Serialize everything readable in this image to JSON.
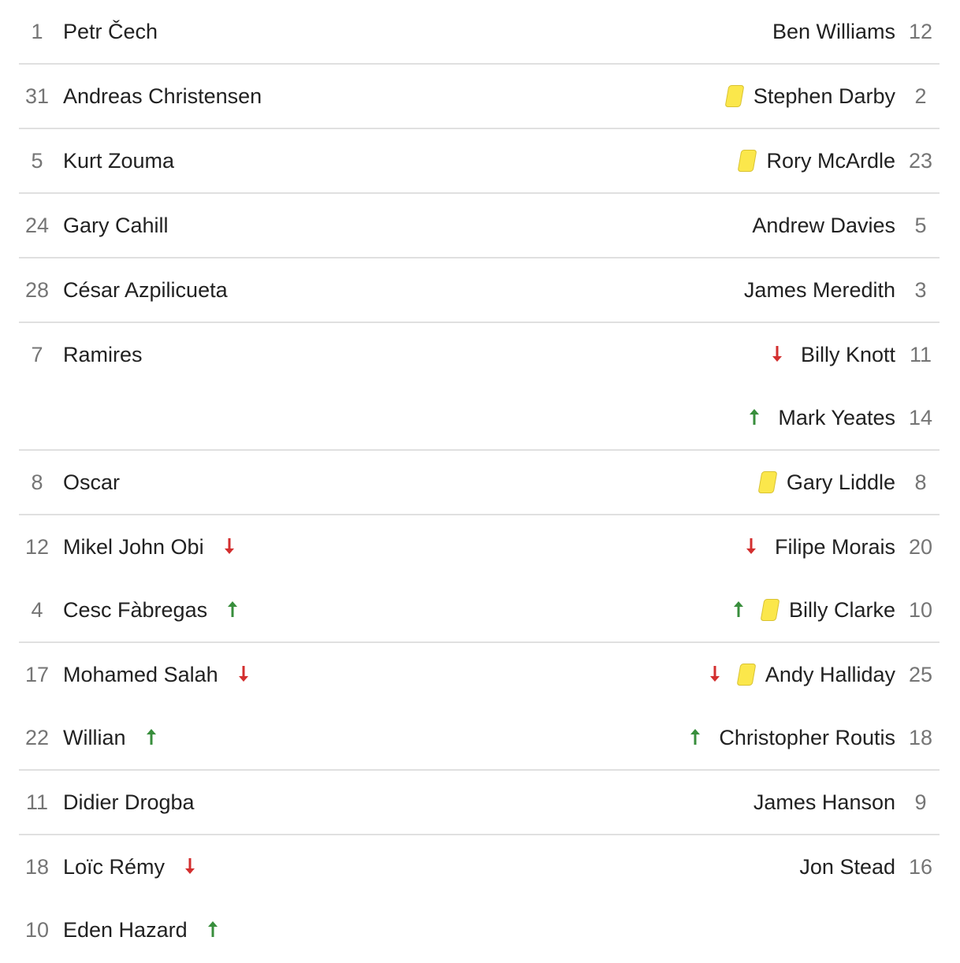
{
  "colors": {
    "sub_off": "#d32f2f",
    "sub_on": "#388e3c",
    "yellow_card": "#fbe74b"
  },
  "groups": [
    {
      "home": [
        {
          "num": "1",
          "name": "Petr Čech",
          "icons": []
        }
      ],
      "away": [
        {
          "num": "12",
          "name": "Ben Williams",
          "icons": []
        }
      ]
    },
    {
      "home": [
        {
          "num": "31",
          "name": "Andreas Christensen",
          "icons": []
        }
      ],
      "away": [
        {
          "num": "2",
          "name": "Stephen Darby",
          "icons": [
            "yellow-card"
          ]
        }
      ]
    },
    {
      "home": [
        {
          "num": "5",
          "name": "Kurt Zouma",
          "icons": []
        }
      ],
      "away": [
        {
          "num": "23",
          "name": "Rory McArdle",
          "icons": [
            "yellow-card"
          ]
        }
      ]
    },
    {
      "home": [
        {
          "num": "24",
          "name": "Gary Cahill",
          "icons": []
        }
      ],
      "away": [
        {
          "num": "5",
          "name": "Andrew Davies",
          "icons": []
        }
      ]
    },
    {
      "home": [
        {
          "num": "28",
          "name": "César Azpilicueta",
          "icons": []
        }
      ],
      "away": [
        {
          "num": "3",
          "name": "James Meredith",
          "icons": []
        }
      ]
    },
    {
      "home": [
        {
          "num": "7",
          "name": "Ramires",
          "icons": []
        }
      ],
      "away": [
        {
          "num": "11",
          "name": "Billy Knott",
          "icons": [
            "sub-off"
          ]
        },
        {
          "num": "14",
          "name": "Mark Yeates",
          "icons": [
            "sub-on"
          ]
        }
      ]
    },
    {
      "home": [
        {
          "num": "8",
          "name": "Oscar",
          "icons": []
        }
      ],
      "away": [
        {
          "num": "8",
          "name": "Gary Liddle",
          "icons": [
            "yellow-card"
          ]
        }
      ]
    },
    {
      "home": [
        {
          "num": "12",
          "name": "Mikel John Obi",
          "icons": [
            "sub-off"
          ]
        },
        {
          "num": "4",
          "name": "Cesc Fàbregas",
          "icons": [
            "sub-on"
          ]
        }
      ],
      "away": [
        {
          "num": "20",
          "name": "Filipe Morais",
          "icons": [
            "sub-off"
          ]
        },
        {
          "num": "10",
          "name": "Billy Clarke",
          "icons": [
            "sub-on",
            "yellow-card"
          ]
        }
      ]
    },
    {
      "home": [
        {
          "num": "17",
          "name": "Mohamed Salah",
          "icons": [
            "sub-off"
          ]
        },
        {
          "num": "22",
          "name": "Willian",
          "icons": [
            "sub-on"
          ]
        }
      ],
      "away": [
        {
          "num": "25",
          "name": "Andy Halliday",
          "icons": [
            "sub-off",
            "yellow-card"
          ]
        },
        {
          "num": "18",
          "name": "Christopher Routis",
          "icons": [
            "sub-on"
          ]
        }
      ]
    },
    {
      "home": [
        {
          "num": "11",
          "name": "Didier Drogba",
          "icons": []
        }
      ],
      "away": [
        {
          "num": "9",
          "name": "James Hanson",
          "icons": []
        }
      ]
    },
    {
      "home": [
        {
          "num": "18",
          "name": "Loïc Rémy",
          "icons": [
            "sub-off"
          ]
        },
        {
          "num": "10",
          "name": "Eden Hazard",
          "icons": [
            "sub-on"
          ]
        }
      ],
      "away": [
        {
          "num": "16",
          "name": "Jon Stead",
          "icons": []
        }
      ]
    }
  ]
}
